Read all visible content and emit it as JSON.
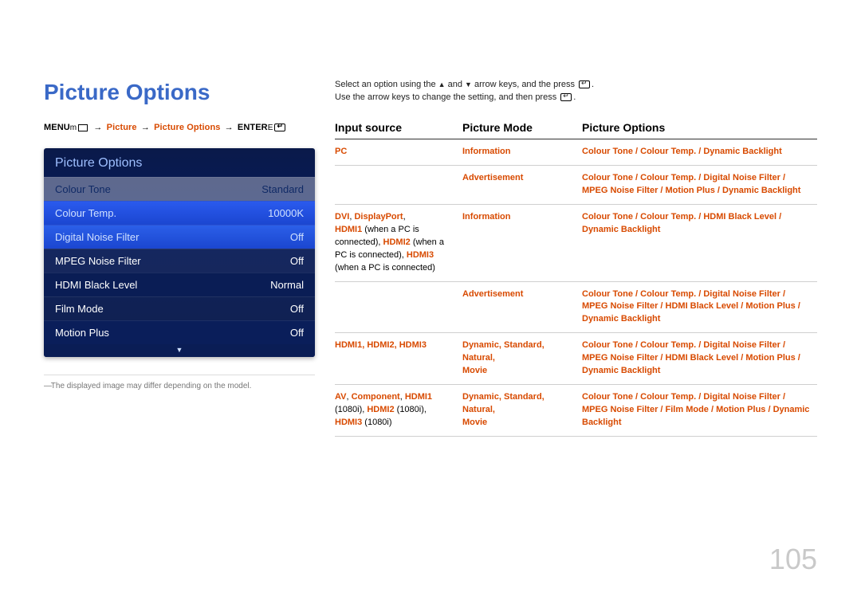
{
  "pageTitle": "Picture Options",
  "breadcrumb": {
    "menu": "MENU",
    "menuIcon": "m",
    "picture": "Picture",
    "pictureOptions": "Picture Options",
    "enter": "ENTER",
    "enterIcon": "E"
  },
  "osd": {
    "title": "Picture Options",
    "rows": [
      {
        "label": "Colour Tone",
        "value": "Standard"
      },
      {
        "label": "Colour Temp.",
        "value": "10000K"
      },
      {
        "label": "Digital Noise Filter",
        "value": "Off"
      },
      {
        "label": "MPEG Noise Filter",
        "value": "Off"
      },
      {
        "label": "HDMI Black Level",
        "value": "Normal"
      },
      {
        "label": "Film Mode",
        "value": "Off"
      },
      {
        "label": "Motion Plus",
        "value": "Off"
      }
    ],
    "scroll": "▼"
  },
  "disclaimer": "The displayed image may differ depending on the model.",
  "instr1a": "Select an option using the ",
  "instr1b": " and ",
  "instr1c": " arrow keys, and the press ",
  "instr1d": ".",
  "instr2a": "Use the arrow keys to change the setting, and then press ",
  "instr2d": ".",
  "triUp": "▲",
  "triDown": "▼",
  "tableHead": {
    "c1": "Input source",
    "c2": "Picture Mode",
    "c3": "Picture Options"
  },
  "rows": {
    "r1": {
      "src": "PC",
      "mode": "Information",
      "opt": "Colour Tone / Colour Temp. / Dynamic Backlight"
    },
    "r2": {
      "mode": "Advertisement",
      "opt_a": "Colour Tone / Colour Temp. / Digital Noise Filter /",
      "opt_b": "MPEG Noise Filter / Motion Plus / Dynamic Backlight"
    },
    "r3": {
      "src_a": "DVI",
      "src_sep1": ", ",
      "src_b": "DisplayPort",
      "src_sep2": ", ",
      "src_c": "HDMI1",
      "src_c_tail": " (when a PC is connected), ",
      "src_d": "HDMI2",
      "src_d_tail": " (when a PC is connected), ",
      "src_e": "HDMI3",
      "src_e_tail": " (when a PC is connected)",
      "mode": "Information",
      "opt_a": "Colour Tone / Colour Temp. / HDMI Black Level /",
      "opt_b": "Dynamic Backlight"
    },
    "r4": {
      "mode": "Advertisement",
      "opt_a": "Colour Tone / Colour Temp. / Digital Noise Filter /",
      "opt_b": "MPEG Noise Filter / HDMI Black Level / Motion Plus /",
      "opt_c": "Dynamic Backlight"
    },
    "r5": {
      "src_a": "HDMI1",
      "src_b": "HDMI2",
      "src_c": "HDMI3",
      "mode_a": "Dynamic",
      "mode_b": "Standard",
      "mode_c": "Natural",
      "mode_d": "Movie",
      "opt_a": "Colour Tone / Colour Temp. / Digital Noise Filter /",
      "opt_b": "MPEG Noise Filter / HDMI Black Level / Motion Plus /",
      "opt_c": "Dynamic Backlight"
    },
    "r6": {
      "src_a": "AV",
      "src_b": "Component",
      "src_c": "HDMI1",
      "src_c_tail": " (1080i), ",
      "src_d": "HDMI2",
      "src_d_tail": " (1080i), ",
      "src_e": "HDMI3",
      "src_e_tail": " (1080i)",
      "mode_a": "Dynamic",
      "mode_b": "Standard",
      "mode_c": "Natural",
      "mode_d": "Movie",
      "opt_a": "Colour Tone / Colour Temp. / Digital Noise Filter /",
      "opt_b": "MPEG Noise Filter / Film Mode / Motion Plus / Dynamic",
      "opt_c": "Backlight"
    }
  },
  "pageNumber": "105"
}
